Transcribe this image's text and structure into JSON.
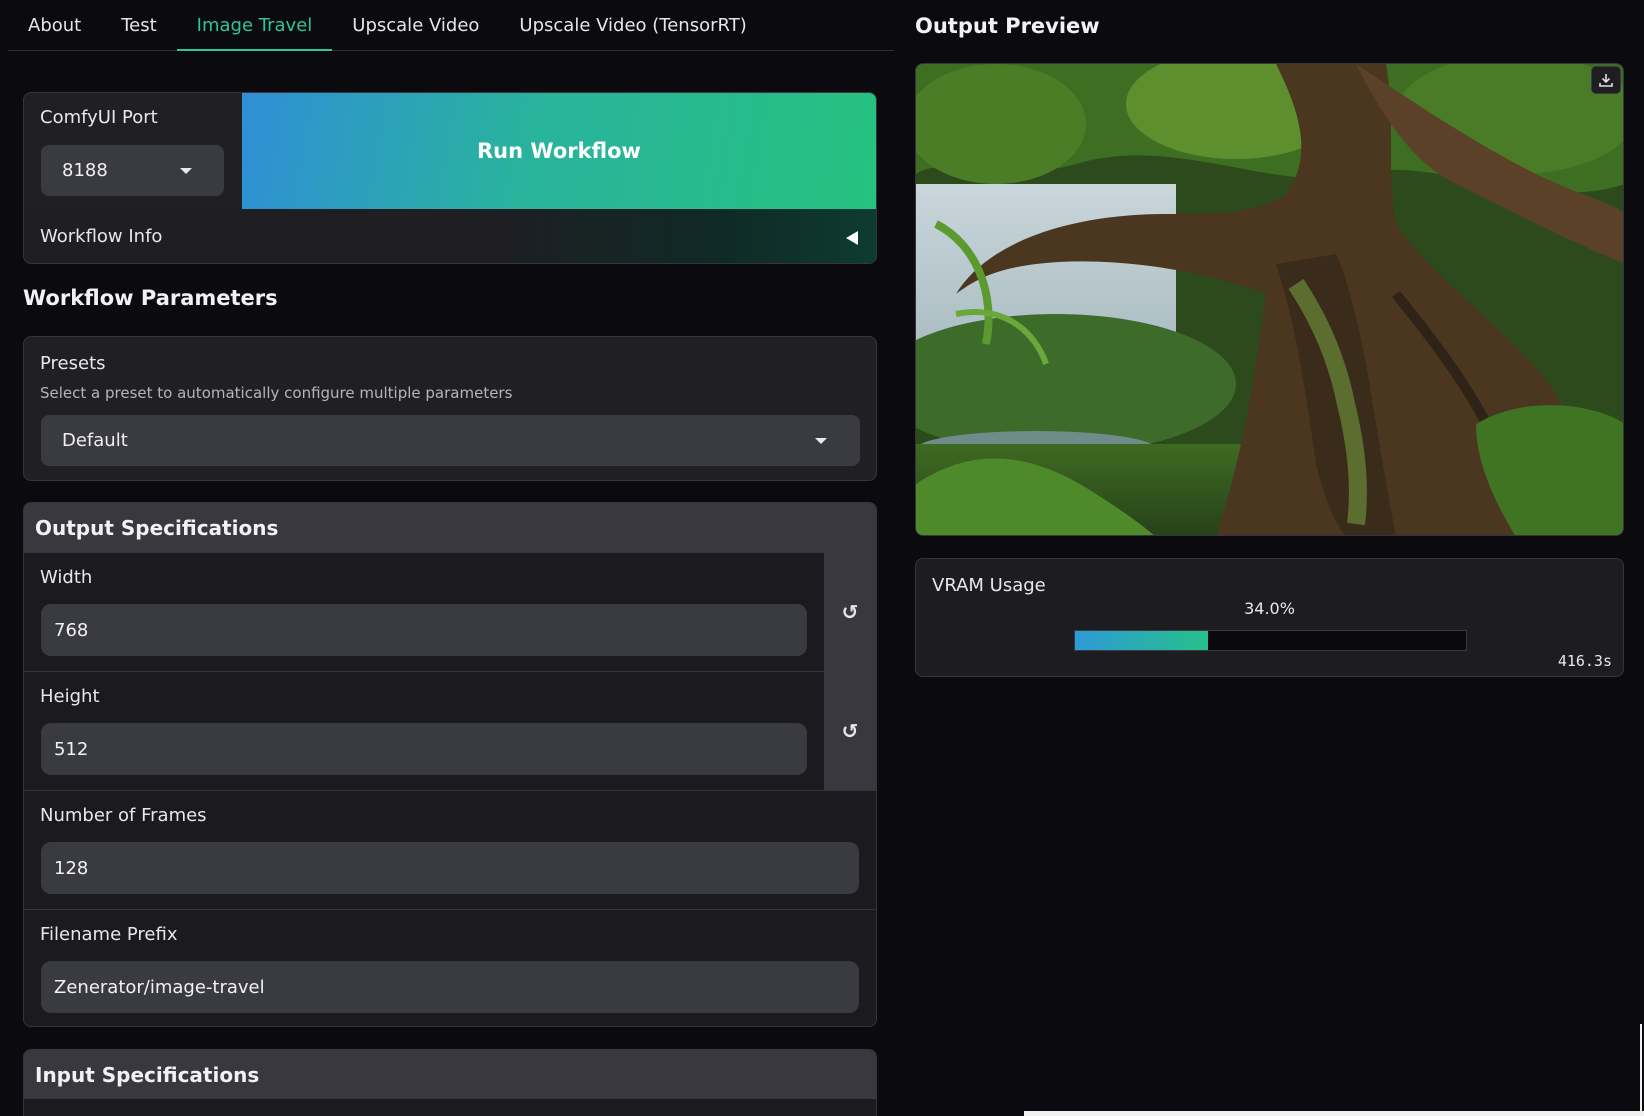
{
  "tabs": [
    {
      "label": "About"
    },
    {
      "label": "Test"
    },
    {
      "label": "Image Travel",
      "active": true
    },
    {
      "label": "Upscale Video"
    },
    {
      "label": "Upscale Video (TensorRT)"
    }
  ],
  "run": {
    "port_label": "ComfyUI Port",
    "port_value": "8188",
    "run_label": "Run Workflow",
    "info_label": "Workflow Info"
  },
  "params": {
    "title": "Workflow Parameters",
    "presets": {
      "label": "Presets",
      "description": "Select a preset to automatically configure multiple parameters",
      "value": "Default"
    }
  },
  "output_spec": {
    "title": "Output Specifications",
    "width": {
      "label": "Width",
      "value": "768"
    },
    "height": {
      "label": "Height",
      "value": "512"
    },
    "frames": {
      "label": "Number of Frames",
      "value": "128"
    },
    "prefix": {
      "label": "Filename Prefix",
      "value": "Zenerator/image-travel"
    },
    "reset_icon": "↺"
  },
  "input_spec": {
    "title": "Input Specifications"
  },
  "preview": {
    "title": "Output Preview",
    "download_icon": "download-icon"
  },
  "vram": {
    "label": "VRAM Usage",
    "percent_text": "34.0%",
    "fraction": 0.34,
    "elapsed": "416.3s"
  },
  "colors": {
    "accent": "#2fc59a",
    "run_gradient_start": "#2f8fd6",
    "run_gradient_end": "#25c27f"
  }
}
